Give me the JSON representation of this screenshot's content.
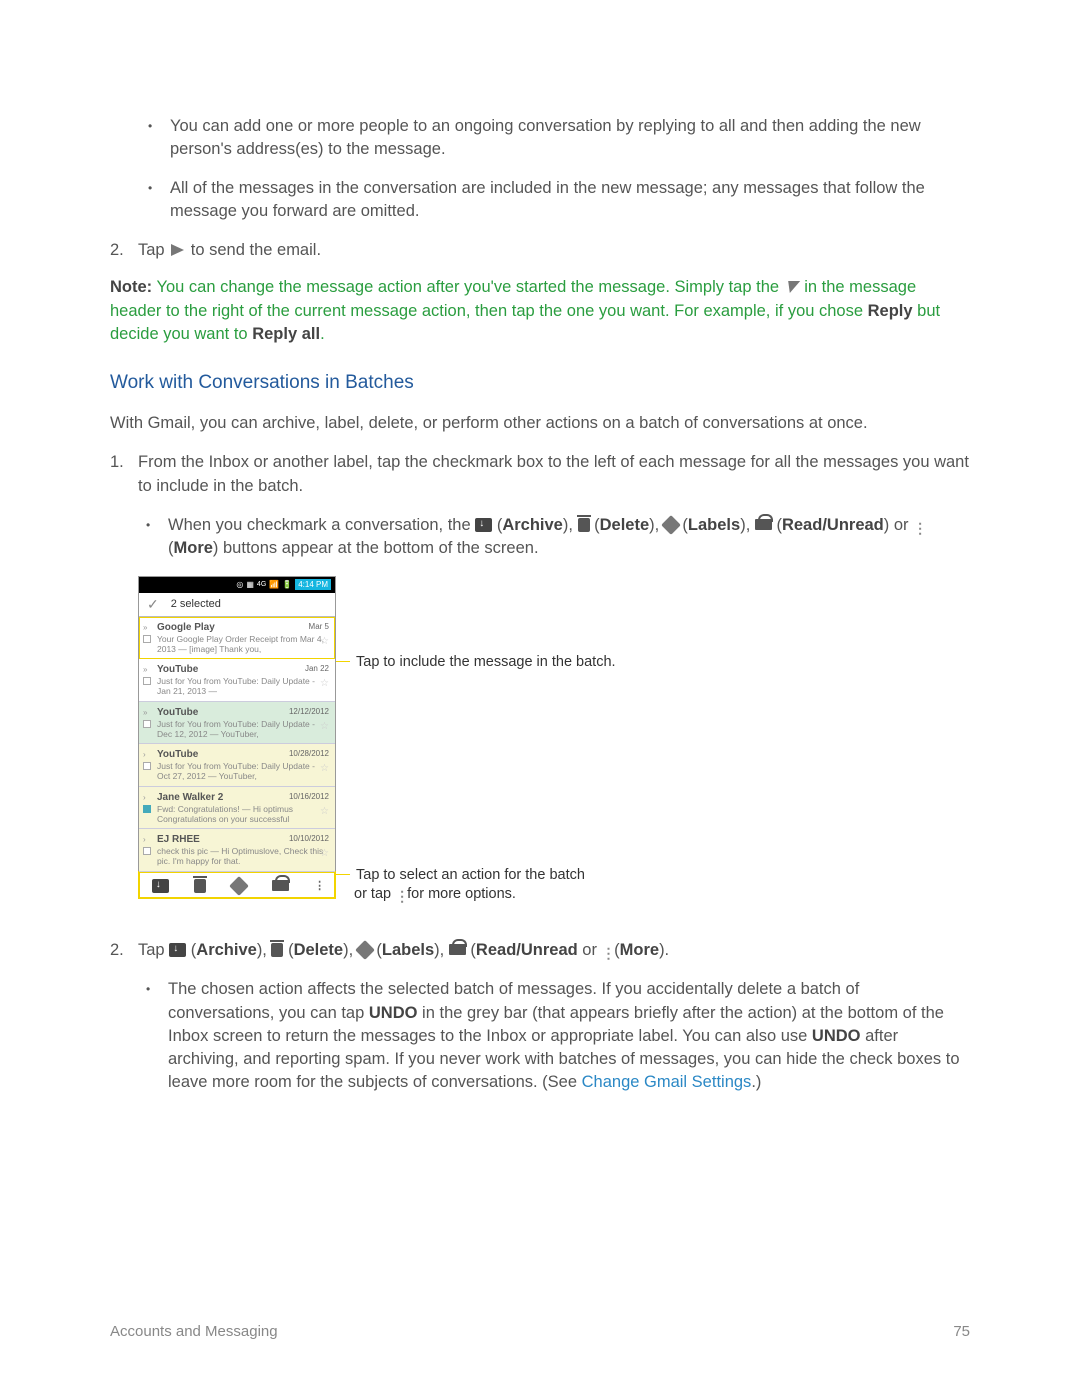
{
  "bullets_top": {
    "b1": "You can add one or more people to an ongoing conversation by replying to all and then adding the new person's address(es) to the message.",
    "b2": "All of the messages in the conversation are included in the new message; any messages that follow the message you forward are omitted."
  },
  "step2_tap": "Tap ",
  "step2_tap_end": " to send the email.",
  "note": {
    "label": "Note:",
    "t1": " You can change the message action after you've started the message. Simply tap the ",
    "t2": " in the message header to the right of the current message action, then tap the one you want. For example, if you chose ",
    "reply": "Reply",
    "t3": " but decide you want to ",
    "replyall": "Reply all",
    "t4": "."
  },
  "section_heading": "Work with Conversations in Batches",
  "section_intro": "With Gmail, you can archive, label, delete, or perform other actions on a batch of conversations at once.",
  "batch_step1": "From the Inbox or another label, tap the checkmark box to the left of each message for all the messages you want to include in the batch.",
  "batch_sub": {
    "t1": "When you checkmark a conversation, the ",
    "archive": "Archive",
    "delete": "Delete",
    "labels": "Labels",
    "read": "Read/Unread",
    "more": "More",
    "t_or": ") or ",
    "t_end": ") buttons appear at the bottom of the screen."
  },
  "phone": {
    "time": "4:14 PM",
    "selected": "2 selected",
    "messages": [
      {
        "title": "Google Play",
        "date": "Mar 5",
        "sub": "Your Google Play Order Receipt from Mar 4, 2013 — [image] Thank you,",
        "sel": false,
        "out": true,
        "chev": "»"
      },
      {
        "title": "YouTube",
        "date": "Jan 22",
        "sub": "Just for You from YouTube: Daily Update - Jan 21, 2013 —",
        "sel": false,
        "chev": "»"
      },
      {
        "title": "YouTube",
        "date": "12/12/2012",
        "sub": "Just for You from YouTube: Daily Update - Dec 12, 2012 — YouTuber,",
        "sel": true,
        "chev": "»"
      },
      {
        "title": "YouTube",
        "date": "10/28/2012",
        "sub": "Just for You from YouTube: Daily Update - Oct 27, 2012 — YouTuber,",
        "sel2": true,
        "chev": "›"
      },
      {
        "title": "Jane Walker 2",
        "date": "10/16/2012",
        "sub": "Fwd: Congratulations! — Hi optimus Congratulations on your successful",
        "sel2": true,
        "checked": true,
        "chev": "›"
      },
      {
        "title": "EJ RHEE",
        "date": "10/10/2012",
        "sub": "check this pic — Hi Optimuslove, Check this pic. I'm happy for that.",
        "sel2": true,
        "chev": "›"
      }
    ]
  },
  "callouts": {
    "c1": "Tap to include the message in the batch.",
    "c2a": "Tap to select an action for the batch",
    "c2b": "or tap ",
    "c2c": " for more options."
  },
  "batch_step2": {
    "tap": "Tap ",
    "archive": "Archive",
    "delete": "Delete",
    "labels": "Labels",
    "read": "Read/Unread",
    "more": "More",
    "or": " or "
  },
  "batch_step2_sub": {
    "t1": "The chosen action affects the selected batch of messages. If you accidentally delete a batch of conversations, you can tap ",
    "undo": "UNDO",
    "t2": " in the grey bar (that appears briefly after the action) at the bottom of the Inbox screen to return the messages to the Inbox or appropriate label. You can also use ",
    "t3": " after archiving, and reporting spam. If you never work with batches of messages, you can hide the check boxes to leave more room for the subjects of conversations. (See ",
    "link": "Change Gmail Settings",
    "t4": ".)"
  },
  "footer": {
    "left": "Accounts and Messaging",
    "right": "75"
  }
}
